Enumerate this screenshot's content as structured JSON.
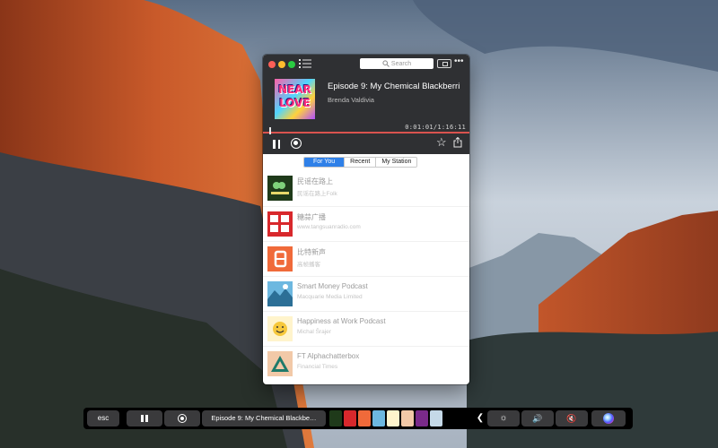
{
  "app": {
    "search": {
      "placeholder": "Search"
    },
    "now_playing": {
      "title": "Episode 9: My Chemical Blackberri",
      "author": "Brenda Valdivia",
      "cover_text": "NEAR\nLOVE",
      "time": "0:01:01/1:16:11",
      "progress_fraction": 0.013
    },
    "tabs": [
      {
        "label": "For You",
        "active": true
      },
      {
        "label": "Recent",
        "active": false
      },
      {
        "label": "My Station",
        "active": false
      }
    ],
    "podcasts": [
      {
        "title": "民谣在路上",
        "subtitle": "民谣在路上Folk",
        "color": "#1f3a1a"
      },
      {
        "title": "糖蒜广播",
        "subtitle": "www.tangsuanradio.com",
        "color": "#d8282c"
      },
      {
        "title": "比特新声",
        "subtitle": "高帧播客",
        "color": "#f06a3a"
      },
      {
        "title": "Smart Money Podcast",
        "subtitle": "Macquarie Media Limited",
        "color": "#6db8e0"
      },
      {
        "title": "Happiness at Work Podcast",
        "subtitle": "Michal Šrajer",
        "color": "#fff4cc"
      },
      {
        "title": "FT Alphachatterbox",
        "subtitle": "Financial Times",
        "color": "#f2c9a8"
      }
    ]
  },
  "touchbar": {
    "esc_label": "esc",
    "title": "Episode 9: My Chemical Blackbe…",
    "strip_colors": [
      "#1f3a1a",
      "#d8282c",
      "#f06a3a",
      "#6db8e0",
      "#fff4cc",
      "#f2c9a8",
      "#7a2a8a",
      "#c5d9e8"
    ]
  },
  "colors": {
    "accent": "#2f80e8",
    "progress": "#d9534f",
    "header_bg": "#2f3033"
  }
}
